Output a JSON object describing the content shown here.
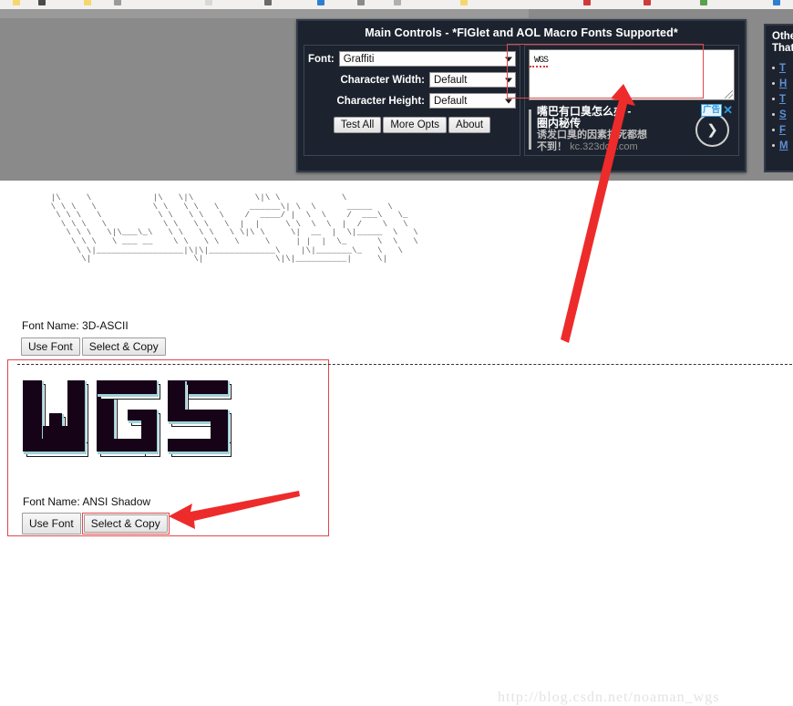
{
  "browser": {
    "bookmarks": [
      {
        "label": "",
        "color": "#f5d76e"
      },
      {
        "label": "",
        "color": "#4a4a4a"
      },
      {
        "label": "",
        "color": "#f5d76e"
      },
      {
        "label": "",
        "color": "#9a9a9a"
      },
      {
        "label": "",
        "color": "#d8d8d8"
      },
      {
        "label": "",
        "color": "#6a6a6a"
      },
      {
        "label": "",
        "color": "#2f7fd0"
      },
      {
        "label": "",
        "color": "#8a8a8a"
      },
      {
        "label": "",
        "color": "#b0b0b0"
      },
      {
        "label": "",
        "color": "#f5d76e"
      },
      {
        "label": "",
        "color": "#cf3a3a"
      },
      {
        "label": "",
        "color": "#cf3a3a"
      },
      {
        "label": "",
        "color": "#59a14f"
      },
      {
        "label": "",
        "color": "#2f7fd0"
      }
    ]
  },
  "main_controls": {
    "title": "Main Controls - *FIGlet and AOL Macro Fonts Supported*",
    "font_label": "Font:",
    "font_value": "Graffiti",
    "char_width_label": "Character Width:",
    "char_width_value": "Default",
    "char_height_label": "Character Height:",
    "char_height_value": "Default",
    "buttons": {
      "test_all": "Test All",
      "more_opts": "More Opts",
      "about": "About"
    },
    "textarea_value": "WGS",
    "textarea_placeholder": ""
  },
  "ad": {
    "line1": "嘴巴有口臭怎么办 -",
    "line2": "圈内秘传",
    "line3": "诱发口臭的因素打死都想",
    "line4_prefix": "不到！ ",
    "url": "kc.323doh.com",
    "label": "广告",
    "close": "✕",
    "go": "❯"
  },
  "other_panel": {
    "title_line1": "Other",
    "title_line2": "That",
    "links": [
      "T",
      "H",
      "T",
      "S",
      "F",
      "M"
    ]
  },
  "results": [
    {
      "font_name_label": "Font Name: 3D-ASCII",
      "use_font": "Use Font",
      "select_copy": "Select & Copy",
      "ascii_art": "      |\\     \\            |\\   \\|\\            \\|\\ \\            \\\n      \\ \\ \\   \\           \\ \\   \\ \\   \\      ______\\| \\  \\      _____   \\\n       \\ \\ \\   \\           \\ \\   \\ \\   \\    /  ____/ |  \\  \\    /  ___\\   \\_\n        \\ \\ \\   \\           \\ \\   \\ \\   \\  |  |     \\ \\  \\  \\  |  /    \\   \\\n         \\ \\ \\   \\|\\___\\_\\   \\ \\   \\ \\   \\ \\|\\ \\     \\|  __  |  \\|_____  \\   \\\n          \\ \\ \\   \\ ___ __    \\ \\   \\ \\   \\     \\     | |  |  \\_      \\  \\   \\\n           \\ \\|_________________|\\|\\|_____________\\    |\\|_______\\_   \\   \\\n            \\|                    \\|              \\|\\|__________|     \\|"
    },
    {
      "font_name_label": "Font Name: ANSI Shadow",
      "use_font": "Use Font",
      "select_copy": "Select & Copy",
      "highlighted": true,
      "rendered_text": "WGS"
    }
  ],
  "watermark": "http://blog.csdn.net/noaman_wgs",
  "annotations": {
    "arrow_to_textarea": "red-arrow-pointing-at-text-input",
    "arrow_to_copy": "red-arrow-pointing-at-select-and-copy-button"
  },
  "colors": {
    "panel_bg": "#1d232e",
    "panel_border": "#323b49",
    "accent_red": "#e0484b",
    "link_blue": "#5d8fd6",
    "page_backdrop": "#8a8a8a"
  }
}
